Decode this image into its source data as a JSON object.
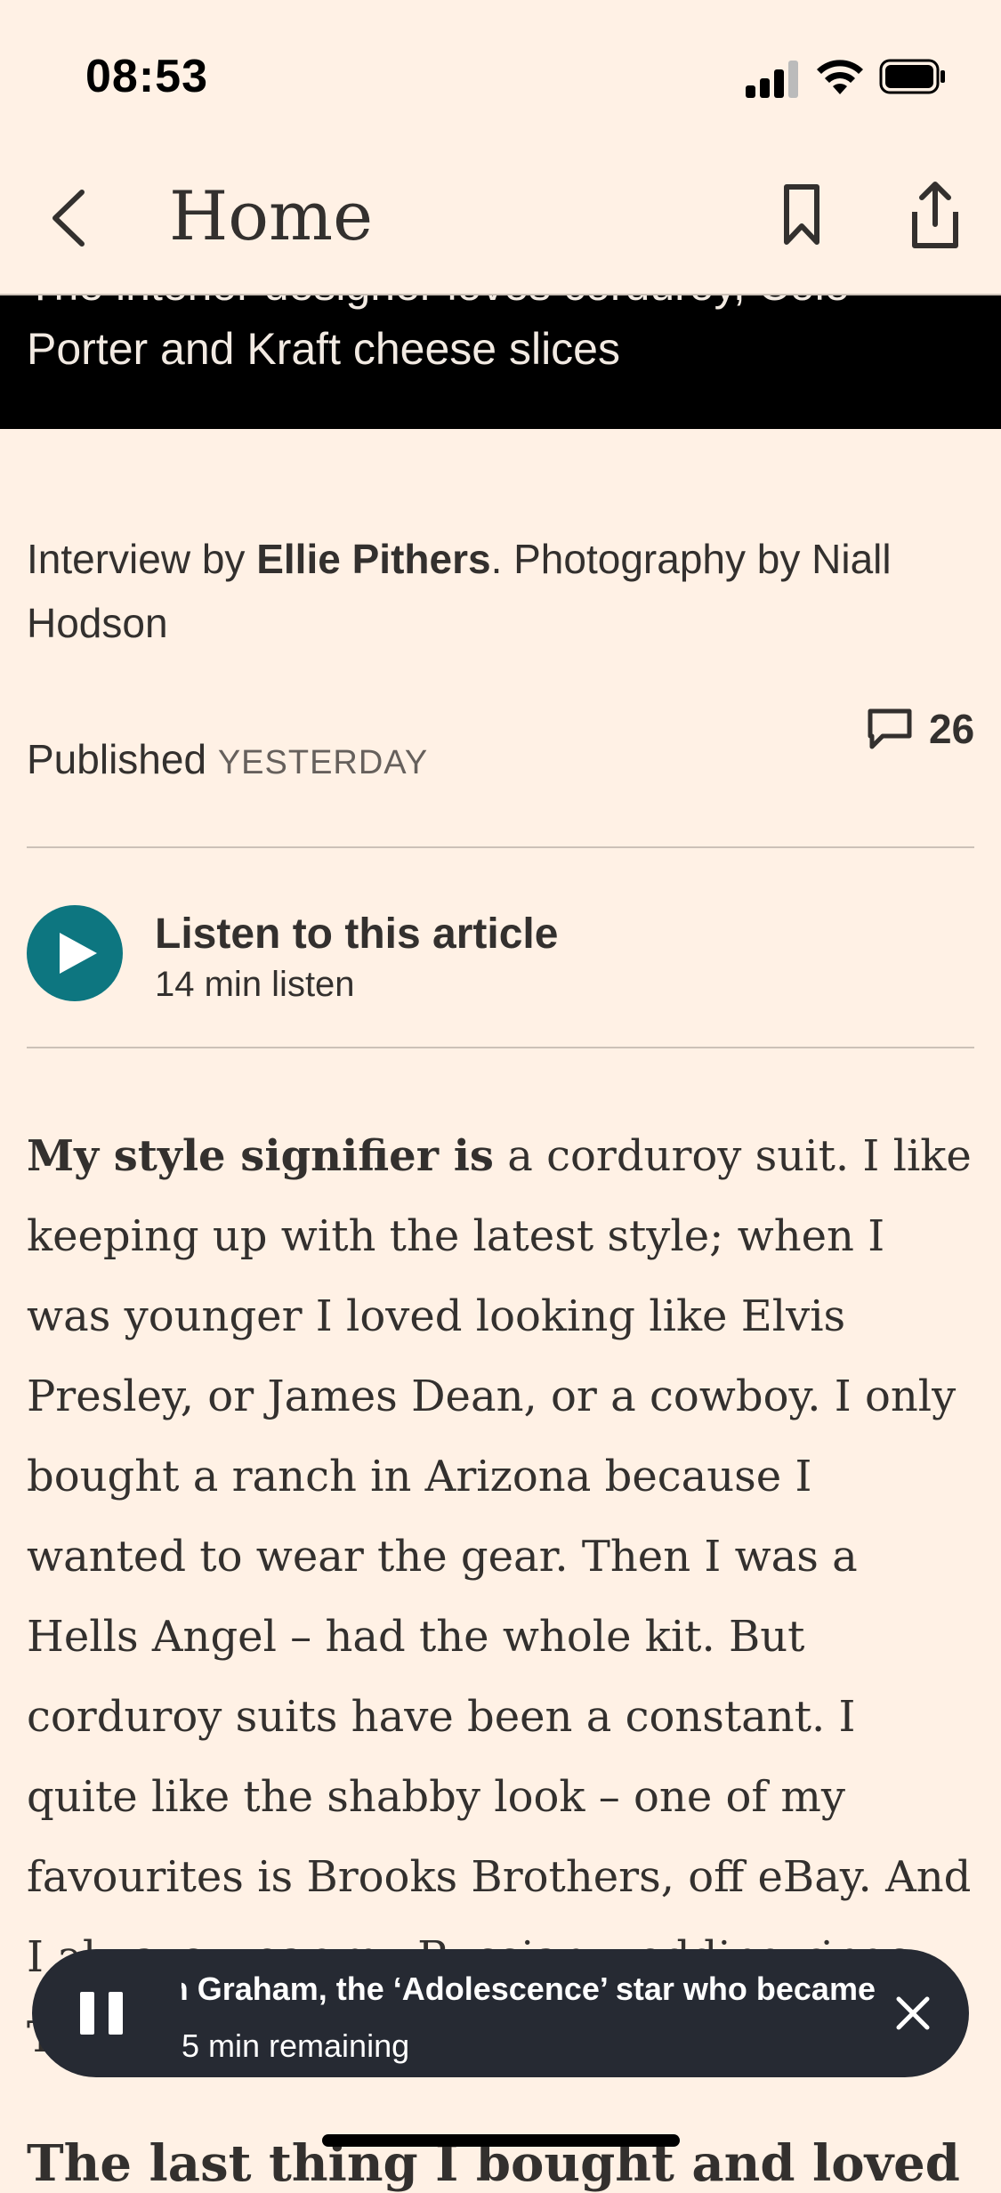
{
  "status_bar": {
    "time": "08:53"
  },
  "nav": {
    "title": "Home"
  },
  "hero": {
    "caption": "The interior designer loves corduroy, Cole Porter and Kraft cheese slices"
  },
  "byline": {
    "prefix": "Interview by ",
    "author": "Ellie Pithers",
    "suffix": ". Photography by Niall Hodson"
  },
  "published": {
    "label": "Published",
    "date": "YESTERDAY"
  },
  "comments": {
    "count": "26"
  },
  "listen": {
    "title": "Listen to this article",
    "duration": "14 min listen"
  },
  "article": {
    "lead": "My style signifier is",
    "body": " a corduroy suit. I like keeping up with the latest style; when I was younger I loved looking like Elvis Presley, or James Dean, or a cowboy. I only bought a ranch in Arizona because I wanted to wear the gear. Then I was a Hells Angel – had the whole kit. But corduroy suits have been a constant. I quite like the shabby look – one of my favourites is Brooks Brothers, off eBay. And I always wear my Russian wedding rings. Two are from H Samuel, one is",
    "next_heading": "The last thing I bought and loved"
  },
  "mini_player": {
    "title": "Owen Cooper and Stephen Graham, the ‘Adolescence’ star who became",
    "remaining": "5 min remaining"
  },
  "colors": {
    "background": "#FFF1E5",
    "accent": "#0D7680",
    "player_bg": "#262A33",
    "hero_bg": "#000000"
  },
  "icons": [
    "back-chevron-icon",
    "bookmark-icon",
    "share-icon",
    "comment-icon",
    "play-icon",
    "pause-icon",
    "close-icon"
  ]
}
